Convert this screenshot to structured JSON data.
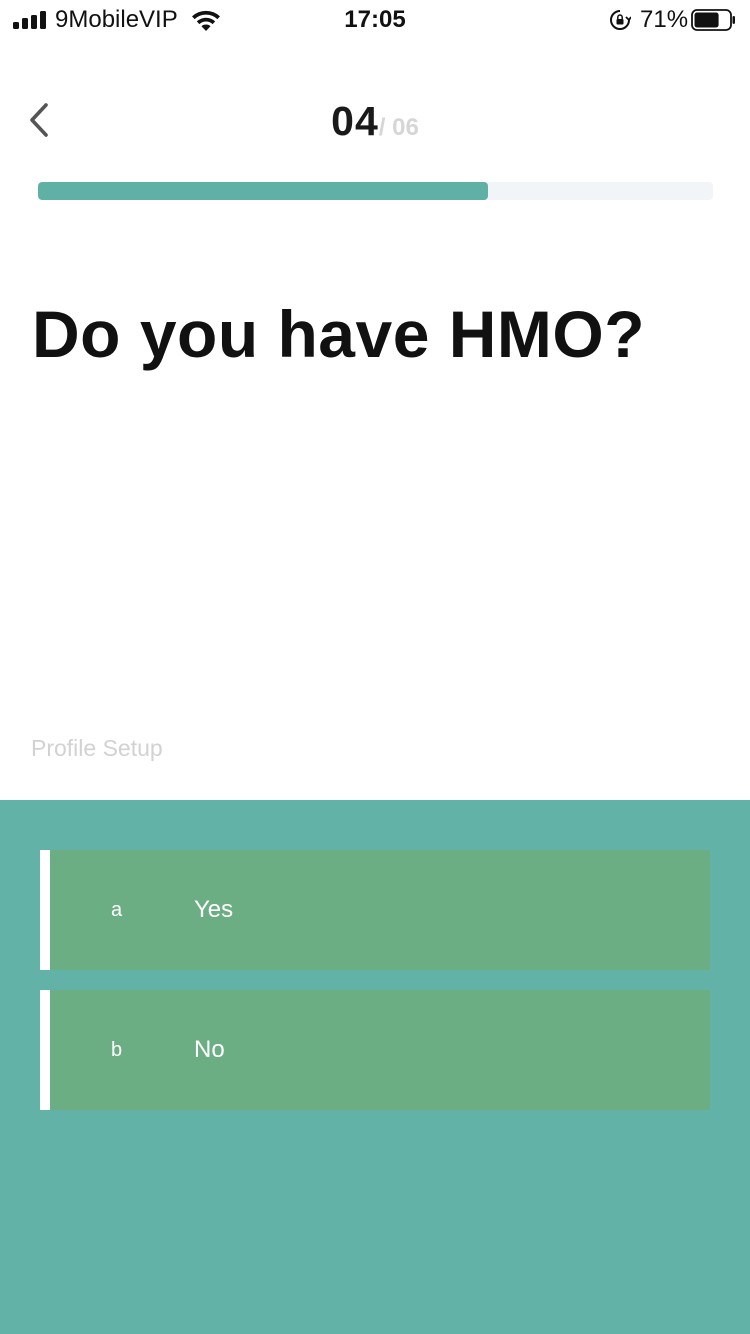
{
  "status_bar": {
    "carrier": "9MobileVIP",
    "time": "17:05",
    "battery_percent": "71%",
    "signal_icon": "cellular-signal-icon",
    "wifi_icon": "wifi-icon",
    "lock_icon": "orientation-lock-icon",
    "battery_icon": "battery-icon",
    "battery_level": 0.71
  },
  "header": {
    "back_icon": "chevron-left-icon",
    "step_current": "04",
    "step_total": "/ 06"
  },
  "progress": {
    "fraction": 0.667,
    "color": "#5fb1a6",
    "track_color": "#f2f5f8"
  },
  "question": {
    "text": "Do you have HMO?"
  },
  "section_label": "Profile Setup",
  "answers": {
    "panel_color": "#62b2a8",
    "option_color": "#6cae84",
    "options": [
      {
        "letter": "a",
        "label": "Yes"
      },
      {
        "letter": "b",
        "label": "No"
      }
    ]
  }
}
